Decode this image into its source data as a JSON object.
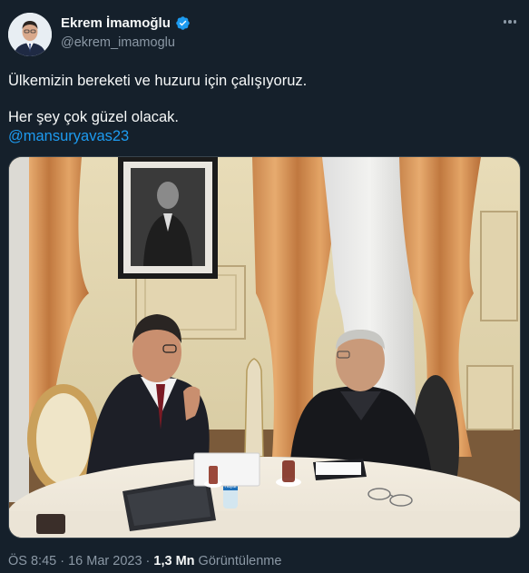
{
  "author": {
    "display_name": "Ekrem İmamoğlu",
    "handle": "@ekrem_imamoglu",
    "verified": true
  },
  "tweet": {
    "line1": "Ülkemizin bereketi ve huzuru için çalışıyoruz.",
    "line2": "Her şey çok güzel olacak.",
    "mention": "@mansuryavas23"
  },
  "meta": {
    "time": "ÖS 8:45",
    "separator1": " · ",
    "date": "16 Mar 2023",
    "separator2": " · ",
    "views_count": "1,3 Mn",
    "views_label": " Görüntülenme"
  },
  "photo": {
    "bottle_label": "Hayat"
  },
  "icons": {
    "verified": "verified-badge-icon",
    "more": "more-horizontal-icon"
  },
  "colors": {
    "background": "#15202b",
    "accent": "#1d9bf0",
    "secondary_text": "#8b98a5"
  }
}
